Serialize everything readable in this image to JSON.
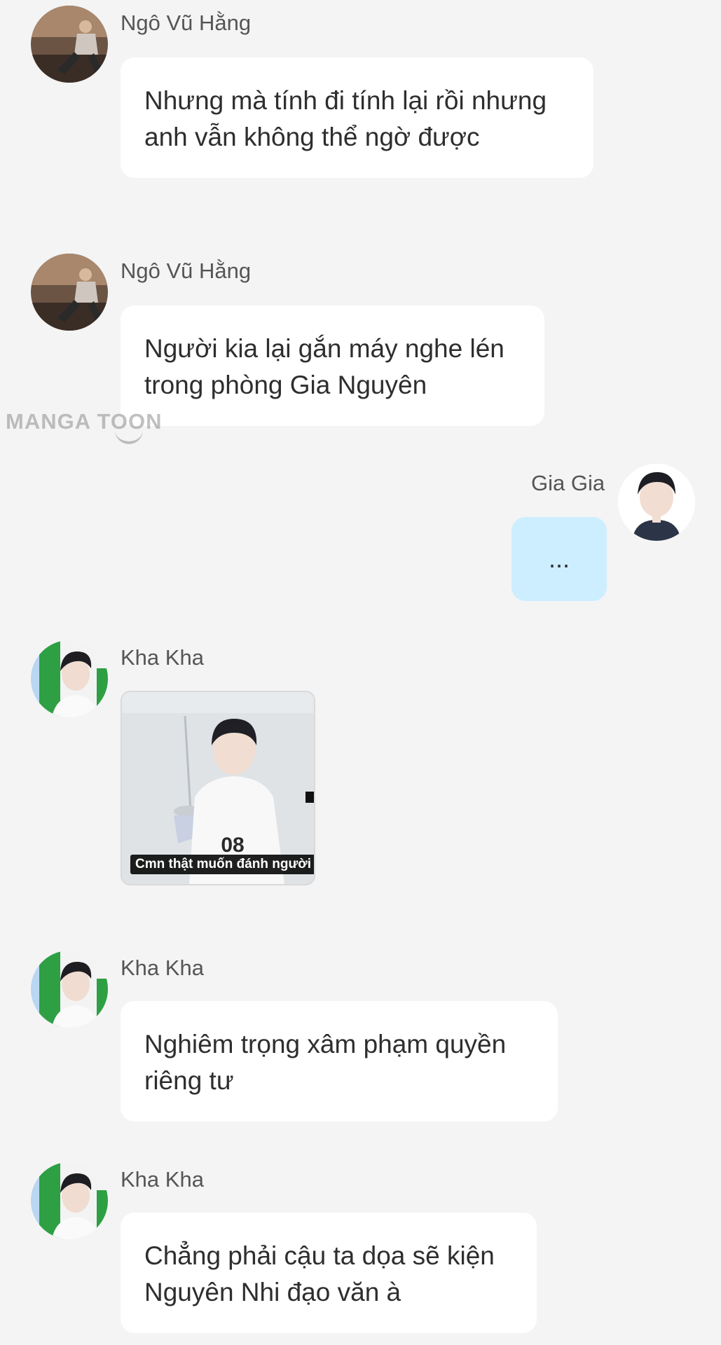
{
  "messages": [
    {
      "sender": "Ngô Vũ Hằng",
      "lines": [
        "Nhưng mà tính đi tính lại rồi nhưng",
        "anh vẫn không thể ngờ được"
      ]
    },
    {
      "sender": "Ngô Vũ Hằng",
      "lines": [
        "Người kia lại gắn máy nghe lén",
        "trong phòng Gia Nguyên"
      ]
    },
    {
      "sender": "Gia Gia",
      "text": "..."
    },
    {
      "sender": "Kha Kha",
      "image_caption": "Cmn thật muốn đánh người"
    },
    {
      "sender": "Kha Kha",
      "lines": [
        "Nghiêm trọng xâm phạm quyền",
        "riêng tư"
      ]
    },
    {
      "sender": "Kha Kha",
      "lines": [
        "Chẳng phải cậu ta dọa sẽ kiện",
        "Nguyên Nhi đạo văn à"
      ]
    }
  ],
  "watermark": "MANGA TOON",
  "colors": {
    "background": "#f4f4f5",
    "incoming_bubble": "#ffffff",
    "outgoing_bubble": "#cdeeff",
    "sender_name": "#555555",
    "message_text": "#2e2e2e"
  },
  "icons": {
    "avatar_ngo_vu_hang": "person-photo-avatar",
    "avatar_gia_gia": "person-photo-avatar",
    "avatar_kha_kha": "person-photo-avatar"
  }
}
